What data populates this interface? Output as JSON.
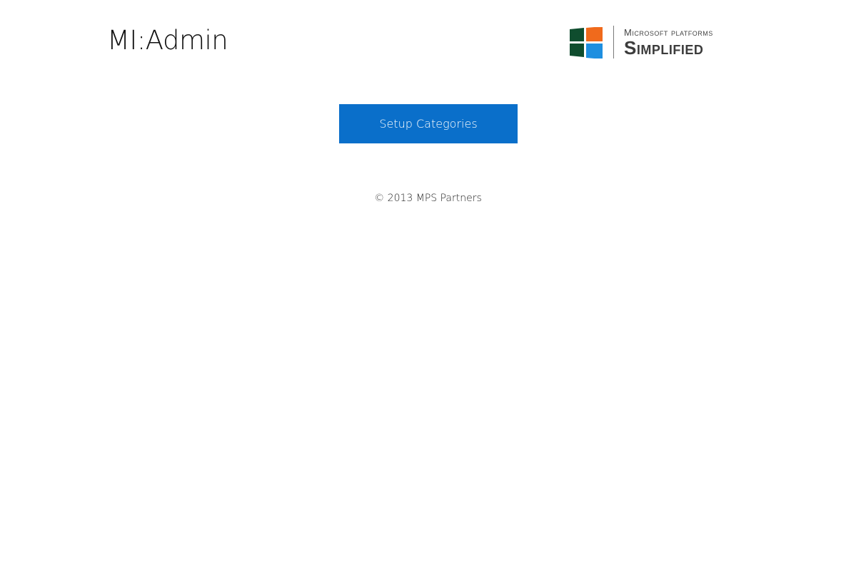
{
  "header": {
    "app_title": "MI:Admin"
  },
  "logo": {
    "line1": "Microsoft Platforms",
    "line2": "Simplified",
    "icon": "windows-logo-icon",
    "colors": {
      "top_left": "#0f4d2e",
      "top_right": "#f06a1c",
      "bottom_left": "#0f4d2e",
      "bottom_right": "#1e8fe0"
    }
  },
  "main": {
    "setup_button_label": "Setup Categories",
    "accent_color": "#0a6fca"
  },
  "footer": {
    "copyright": "© 2013 MPS Partners"
  }
}
